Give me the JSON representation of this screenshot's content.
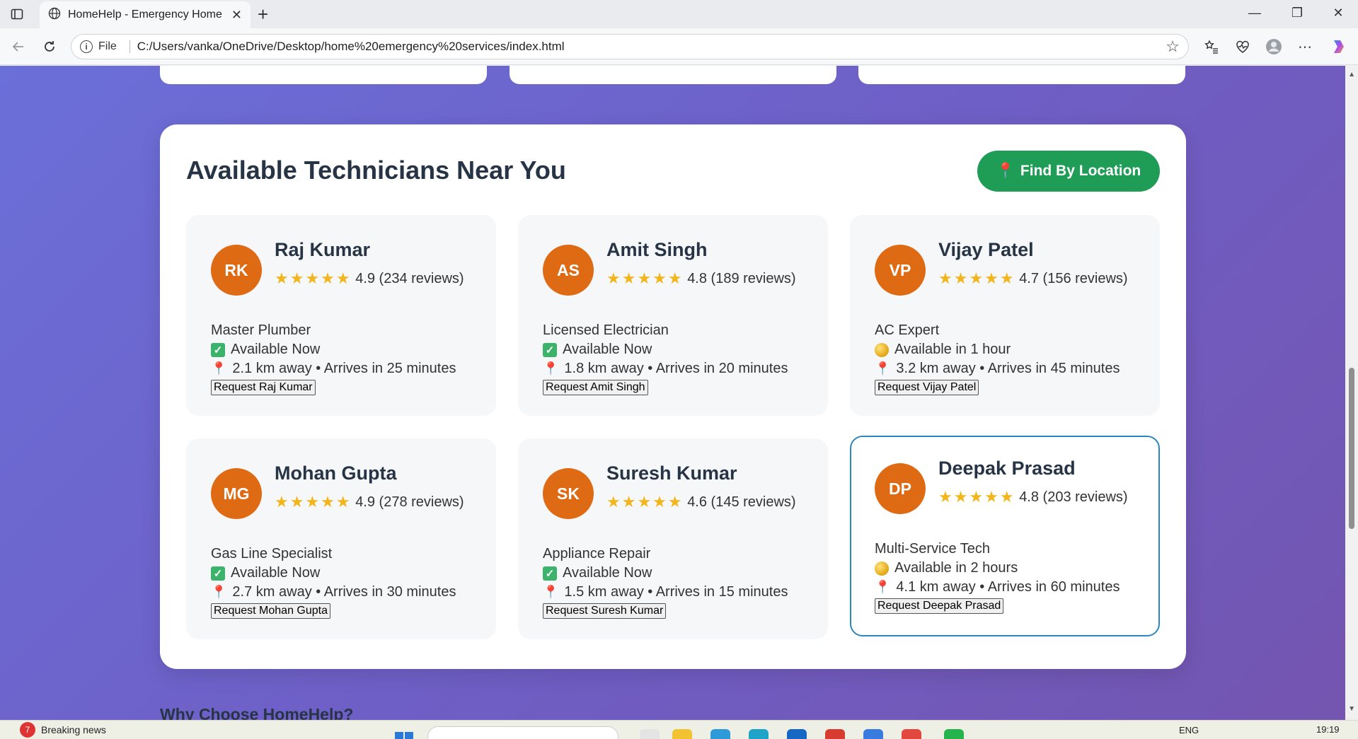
{
  "browser": {
    "tab_title": "HomeHelp - Emergency Home Se",
    "address_scheme": "File",
    "url": "C:/Users/vanka/OneDrive/Desktop/home%20emergency%20services/index.html"
  },
  "page": {
    "section_title": "Available Technicians Near You",
    "find_button": {
      "icon": "📍",
      "label": "Find By Location"
    },
    "next_section_title": "Why Choose HomeHelp?",
    "technicians": [
      {
        "initials": "RK",
        "name": "Raj Kumar",
        "stars": "★★★★★",
        "rating_text": "4.9 (234 reviews)",
        "specialty": "Master Plumber",
        "status_type": "now",
        "availability": "Available Now",
        "distance": "2.1 km away • Arrives in 25 minutes",
        "request_label": "Request Raj Kumar"
      },
      {
        "initials": "AS",
        "name": "Amit Singh",
        "stars": "★★★★★",
        "rating_text": "4.8 (189 reviews)",
        "specialty": "Licensed Electrician",
        "status_type": "now",
        "availability": "Available Now",
        "distance": "1.8 km away • Arrives in 20 minutes",
        "request_label": "Request Amit Singh"
      },
      {
        "initials": "VP",
        "name": "Vijay Patel",
        "stars": "★★★★★",
        "rating_text": "4.7 (156 reviews)",
        "specialty": "AC Expert",
        "status_type": "later",
        "availability": "Available in 1 hour",
        "distance": "3.2 km away • Arrives in 45 minutes",
        "request_label": "Request Vijay Patel"
      },
      {
        "initials": "MG",
        "name": "Mohan Gupta",
        "stars": "★★★★★",
        "rating_text": "4.9 (278 reviews)",
        "specialty": "Gas Line Specialist",
        "status_type": "now",
        "availability": "Available Now",
        "distance": "2.7 km away • Arrives in 30 minutes",
        "request_label": "Request Mohan Gupta"
      },
      {
        "initials": "SK",
        "name": "Suresh Kumar",
        "stars": "★★★★★",
        "rating_text": "4.6 (145 reviews)",
        "specialty": "Appliance Repair",
        "status_type": "now",
        "availability": "Available Now",
        "distance": "1.5 km away • Arrives in 15 minutes",
        "request_label": "Request Suresh Kumar"
      },
      {
        "initials": "DP",
        "name": "Deepak Prasad",
        "stars": "★★★★★",
        "rating_text": "4.8 (203 reviews)",
        "specialty": "Multi-Service Tech",
        "status_type": "later",
        "availability": "Available in 2 hours",
        "distance": "4.1 km away • Arrives in 60 minutes",
        "request_label": "Request Deepak Prasad"
      }
    ]
  },
  "taskbar": {
    "news_badge": "7",
    "news_label": "Breaking news",
    "language": "ENG",
    "time": "19:19"
  },
  "colors": {
    "accent_green": "#1f9d57",
    "avatar_orange": "#df6a14",
    "highlight_border": "#2e86c1",
    "background_gradient_start": "#6b6fd8",
    "background_gradient_end": "#7455b0"
  }
}
